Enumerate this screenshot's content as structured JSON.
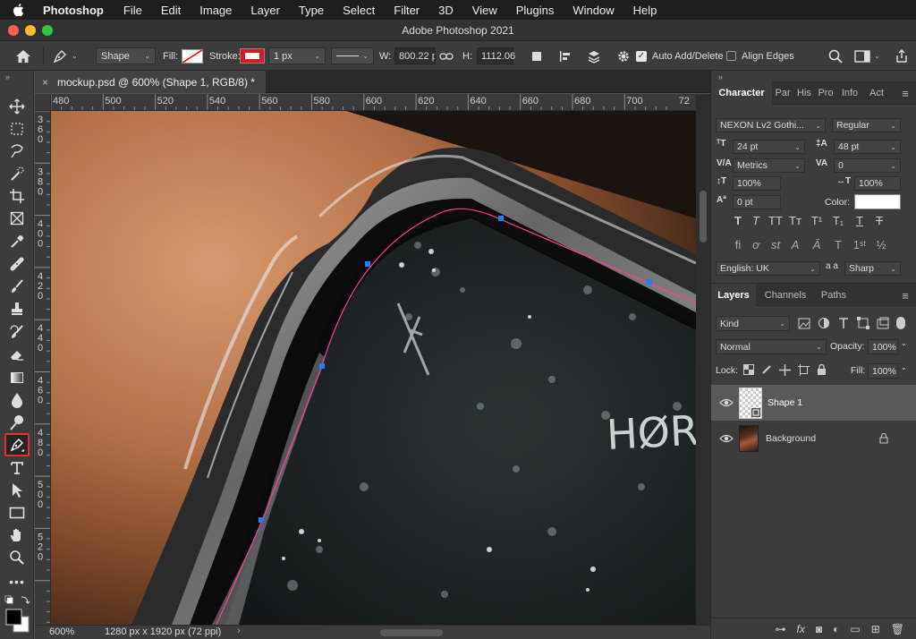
{
  "menubar": {
    "app": "Photoshop",
    "items": [
      "File",
      "Edit",
      "Image",
      "Layer",
      "Type",
      "Select",
      "Filter",
      "3D",
      "View",
      "Plugins",
      "Window",
      "Help"
    ]
  },
  "window": {
    "title": "Adobe Photoshop 2021"
  },
  "options": {
    "mode": "Shape",
    "fill_label": "Fill:",
    "stroke_label": "Stroke:",
    "stroke_width": "1 px",
    "w_label": "W:",
    "w_value": "800.22 p",
    "h_label": "H:",
    "h_value": "1112.06",
    "auto_add_delete": "Auto Add/Delete",
    "align_edges": "Align Edges"
  },
  "document": {
    "tab_title": "mockup.psd @ 600% (Shape 1, RGB/8) *",
    "zoom": "600%",
    "dimensions": "1280 px x 1920 px (72 ppi)"
  },
  "hruler": [
    "480",
    "500",
    "520",
    "540",
    "560",
    "580",
    "600",
    "620",
    "640",
    "660",
    "680",
    "700",
    "72"
  ],
  "vruler": [
    "3\n6\n0",
    "3\n8\n0",
    "4\n0\n0",
    "4\n2\n0",
    "4\n4\n0",
    "4\n6\n0",
    "4\n8\n0",
    "5\n0\n0",
    "5\n2\n0"
  ],
  "character": {
    "tabs": [
      "Character",
      "Par",
      "His",
      "Pro",
      "Info",
      "Act"
    ],
    "font_family": "NEXON Lv2 Gothi...",
    "font_style": "Regular",
    "font_size": "24 pt",
    "leading": "48 pt",
    "kerning": "Metrics",
    "tracking": "0",
    "vscale": "100%",
    "hscale": "100%",
    "baseline": "0 pt",
    "color_label": "Color:",
    "color": "#ffffff",
    "language": "English: UK",
    "aa_label": "a a",
    "antialias": "Sharp"
  },
  "layers": {
    "tabs": [
      "Layers",
      "Channels",
      "Paths"
    ],
    "kind": "Kind",
    "blend": "Normal",
    "opacity_label": "Opacity:",
    "opacity": "100%",
    "lock_label": "Lock:",
    "fill_label": "Fill:",
    "fill": "100%",
    "items": [
      {
        "name": "Shape 1",
        "selected": true
      },
      {
        "name": "Background",
        "locked": true
      }
    ]
  }
}
